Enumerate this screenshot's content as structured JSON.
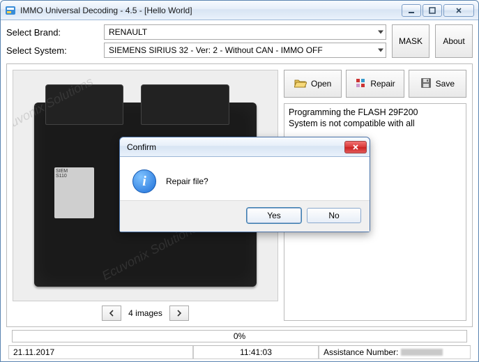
{
  "window": {
    "title": "IMMO Universal Decoding - 4.5 - [Hello World]"
  },
  "selectors": {
    "brand_label": "Select Brand:",
    "brand_value": "RENAULT",
    "system_label": "Select System:",
    "system_value": "SIEMENS SIRIUS 32 - Ver: 2 - Without CAN -  IMMO OFF"
  },
  "side_buttons": {
    "mask": "MASK",
    "about": "About"
  },
  "actions": {
    "open": "Open",
    "repair": "Repair",
    "save": "Save"
  },
  "log": {
    "line1": "Programming the FLASH 29F200",
    "line2": "System is not compatible with all"
  },
  "image_nav": {
    "count_text": "4 images"
  },
  "ecu_label": {
    "l1": "SIEM",
    "l2": "S110"
  },
  "watermarks": {
    "text": "Ecuvonix Solutions"
  },
  "progress": {
    "text": "0%"
  },
  "status": {
    "date": "21.11.2017",
    "time": "11:41:03",
    "assist_label": "Assistance Number:"
  },
  "dialog": {
    "title": "Confirm",
    "message": "Repair file?",
    "yes": "Yes",
    "no": "No"
  }
}
